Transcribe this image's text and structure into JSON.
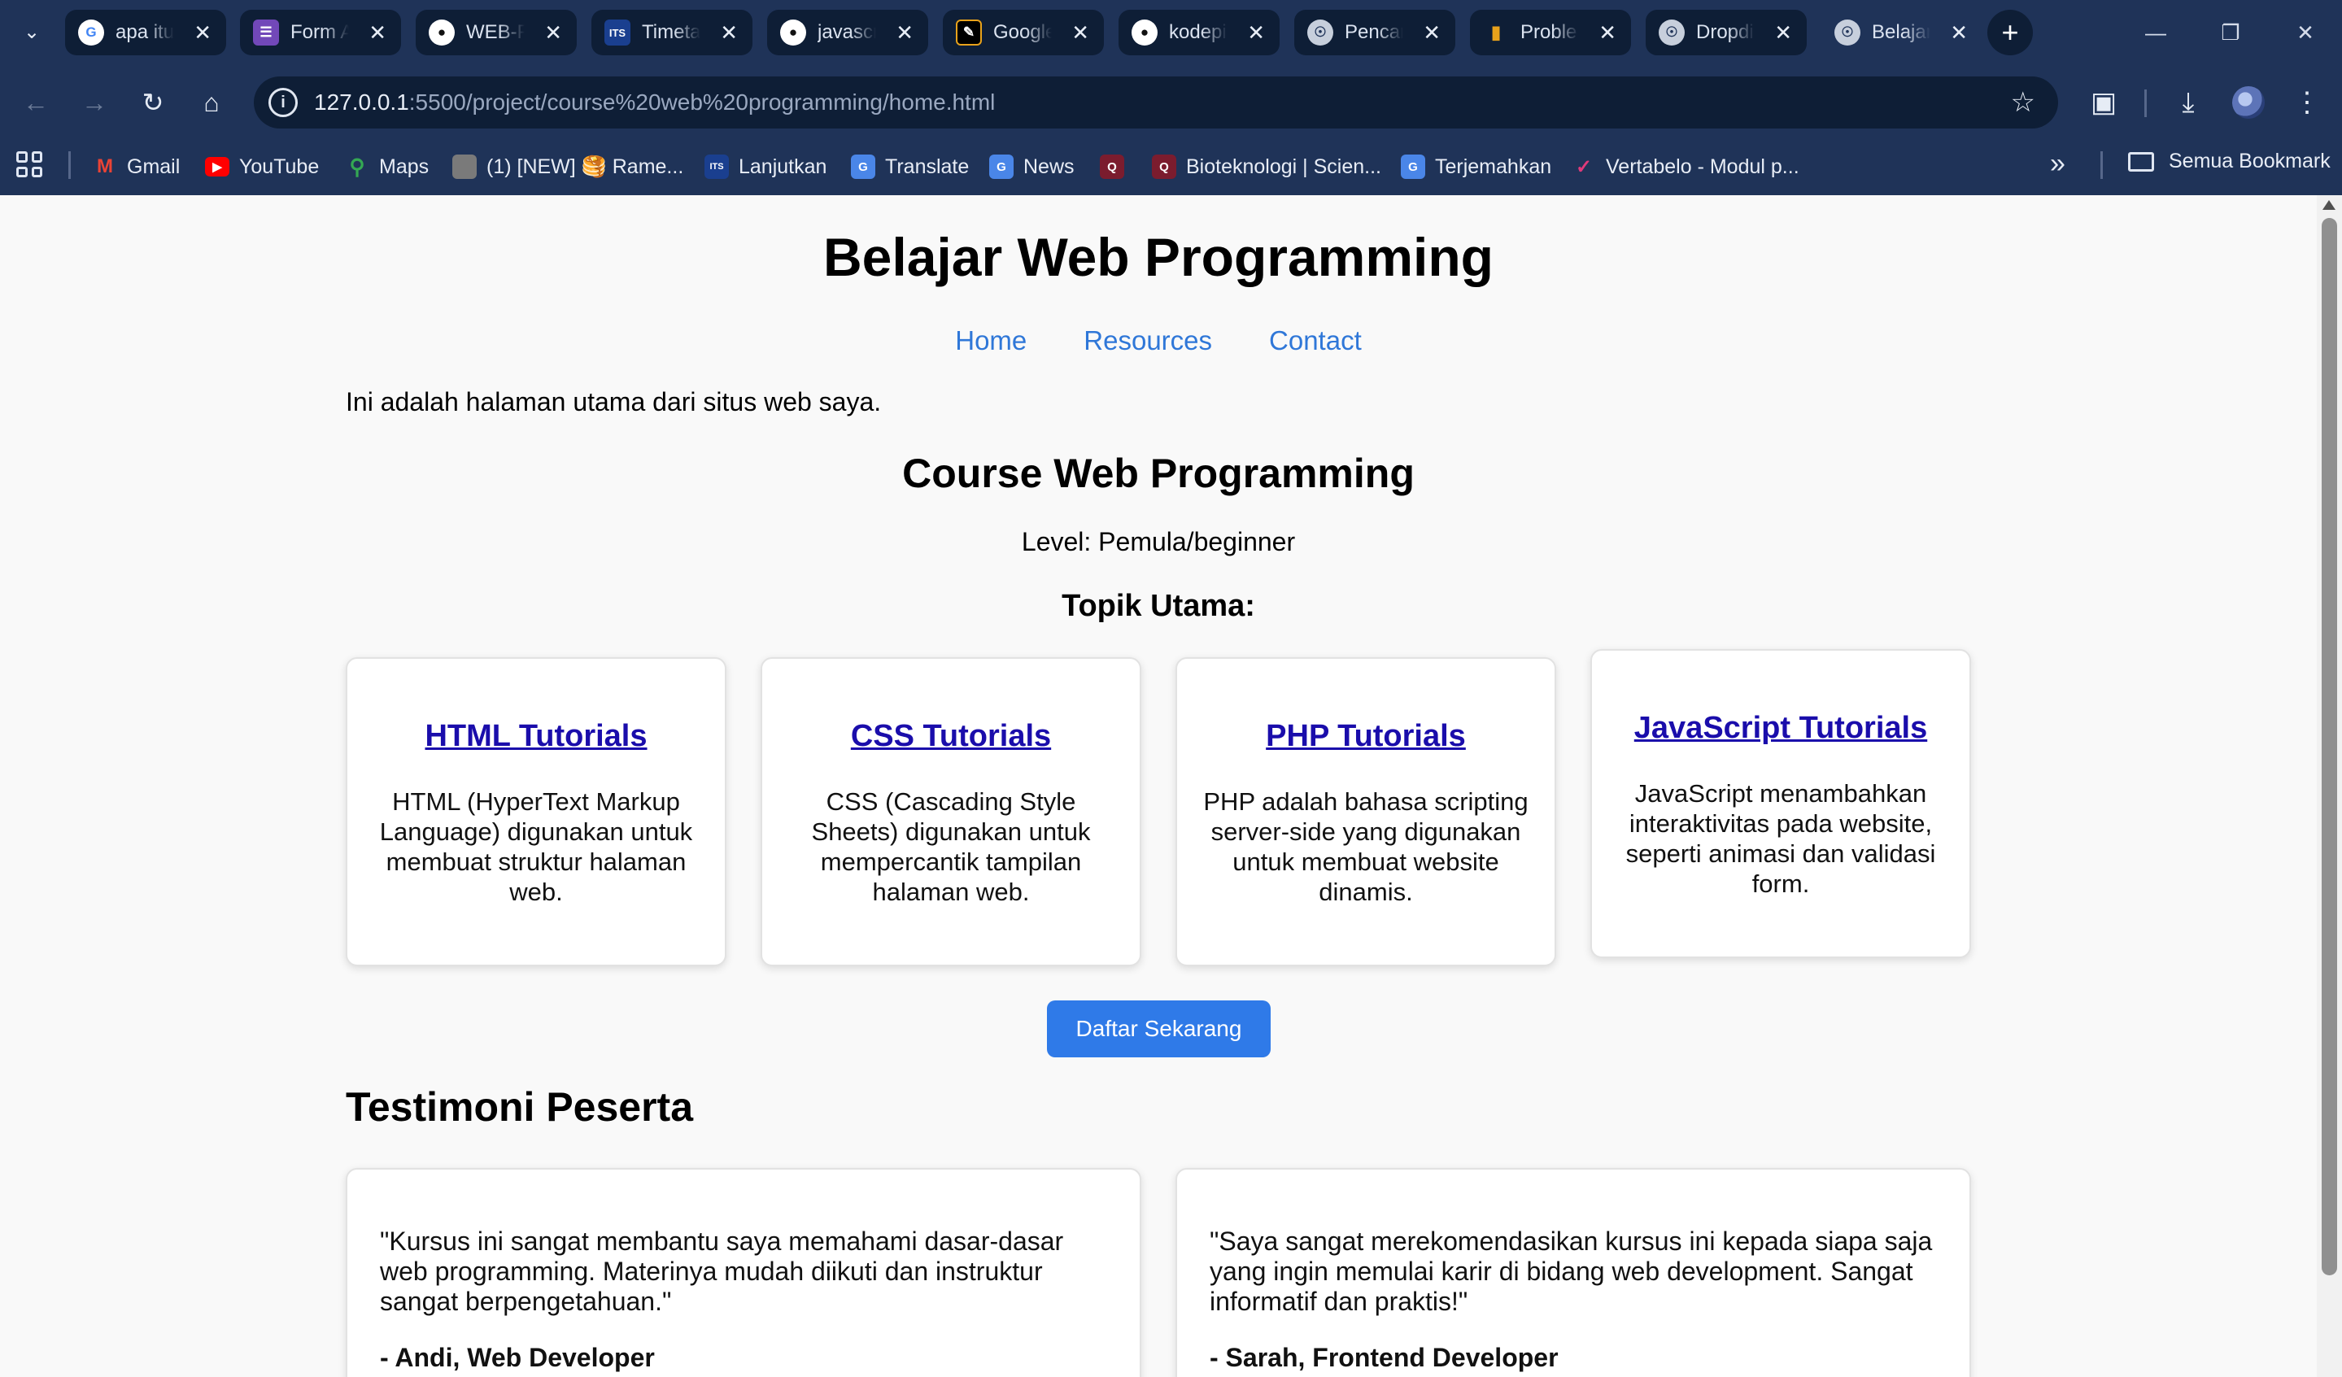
{
  "browser": {
    "tabs": [
      {
        "title": "apa itu",
        "icon": "google-icon",
        "color": "#ffffff"
      },
      {
        "title": "Form A",
        "icon": "forms-icon",
        "color": "#7248b9"
      },
      {
        "title": "WEB-P",
        "icon": "github-icon",
        "color": "#ffffff"
      },
      {
        "title": "Timeta",
        "icon": "its-icon",
        "color": "#1a3f8f"
      },
      {
        "title": "javascr",
        "icon": "github-icon",
        "color": "#ffffff"
      },
      {
        "title": "Google",
        "icon": "classroom-icon",
        "color": "#000000"
      },
      {
        "title": "kodepi",
        "icon": "github-icon",
        "color": "#ffffff"
      },
      {
        "title": "Pencar",
        "icon": "globe-icon",
        "color": "#c7cfdc"
      },
      {
        "title": "Proble",
        "icon": "chart-icon",
        "color": "#e8a21b"
      },
      {
        "title": "Dropdi",
        "icon": "globe-icon",
        "color": "#c7cfdc"
      },
      {
        "title": "Belajar",
        "icon": "globe-icon",
        "color": "#c7cfdc",
        "active": true
      }
    ],
    "url_host": "127.0.0.1",
    "url_path": ":5500/project/course%20web%20programming/home.html",
    "bookmarks": [
      {
        "label": "Gmail",
        "icon": "gmail-icon",
        "color": "#ea4335"
      },
      {
        "label": "YouTube",
        "icon": "youtube-icon",
        "color": "#ff0000"
      },
      {
        "label": "Maps",
        "icon": "maps-icon",
        "color": "#34a853"
      },
      {
        "label": "(1) [NEW] 🥞 Rame...",
        "icon": "site-icon",
        "color": "#7a7a7a"
      },
      {
        "label": "Lanjutkan",
        "icon": "its-icon",
        "color": "#1a3f8f"
      },
      {
        "label": "Translate",
        "icon": "translate-icon",
        "color": "#4a86e8"
      },
      {
        "label": "News",
        "icon": "news-icon",
        "color": "#4a86e8"
      },
      {
        "label": "",
        "icon": "quizizz-icon",
        "color": "#7b1c2e"
      },
      {
        "label": "Bioteknologi | Scien...",
        "icon": "quizizz-icon",
        "color": "#7b1c2e"
      },
      {
        "label": "Terjemahkan",
        "icon": "translate-icon",
        "color": "#4a86e8"
      },
      {
        "label": "Vertabelo - Modul p...",
        "icon": "vertabelo-icon",
        "color": "#e03a7a"
      }
    ],
    "all_bookmarks": "Semua Bookmark"
  },
  "page": {
    "title": "Belajar Web Programming",
    "nav": [
      "Home",
      "Resources",
      "Contact"
    ],
    "intro": "Ini adalah halaman utama dari situs web saya.",
    "course_title": "Course Web Programming",
    "level": "Level: Pemula/beginner",
    "topik": "Topik Utama:",
    "cards": [
      {
        "title": "HTML Tutorials",
        "desc": "HTML (HyperText Markup Language) digunakan untuk membuat struktur halaman web."
      },
      {
        "title": "CSS Tutorials",
        "desc": "CSS (Cascading Style Sheets) digunakan untuk mempercantik tampilan halaman web."
      },
      {
        "title": "PHP Tutorials",
        "desc": "PHP adalah bahasa scripting server-side yang digunakan untuk membuat website dinamis."
      },
      {
        "title": "JavaScript Tutorials",
        "desc": "JavaScript menambahkan interaktivitas pada website, seperti animasi dan validasi form."
      }
    ],
    "cta": "Daftar Sekarang",
    "testimoni_heading": "Testimoni Peserta",
    "testimonials": [
      {
        "quote": "\"Kursus ini sangat membantu saya memahami dasar-dasar web programming. Materinya mudah diikuti dan instruktur sangat berpengetahuan.\"",
        "author": "- Andi, Web Developer"
      },
      {
        "quote": "\"Saya sangat merekomendasikan kursus ini kepada siapa saja yang ingin memulai karir di bidang web development. Sangat informatif dan praktis!\"",
        "author": "- Sarah, Frontend Developer"
      }
    ]
  }
}
